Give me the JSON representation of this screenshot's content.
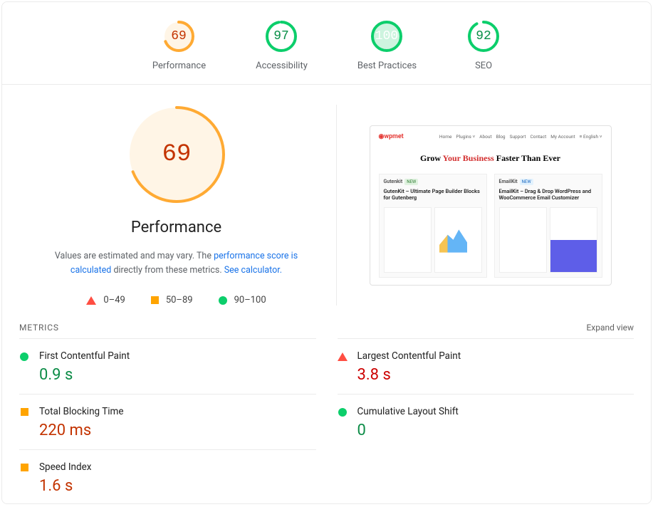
{
  "gauges": [
    {
      "label": "Performance",
      "value": 69,
      "color": "#fa3",
      "bg": "#fff5e6",
      "fill": "#fa3",
      "text": "#c33300"
    },
    {
      "label": "Accessibility",
      "value": 97,
      "color": "#0cce6b",
      "bg": "#fff",
      "fill": "none",
      "text": "#0a8f48"
    },
    {
      "label": "Best Practices",
      "value": 100,
      "color": "#0cce6b",
      "bg": "#e8faf0",
      "fill": "#0cce6b",
      "filltext": "#fff",
      "text": "#0a8f48"
    },
    {
      "label": "SEO",
      "value": 92,
      "color": "#0cce6b",
      "bg": "#fff",
      "fill": "none",
      "text": "#0a8f48"
    }
  ],
  "bigGauge": {
    "label": "Performance",
    "value": 69,
    "color": "#fa3",
    "bg": "#fff5e6",
    "text": "#c33300"
  },
  "disclaimer": {
    "prefix": "Values are estimated and may vary. The ",
    "link1": "performance score is calculated",
    "mid": " directly from these metrics. ",
    "link2": "See calculator."
  },
  "legend": {
    "fail": "0–49",
    "avg": "50–89",
    "pass": "90–100"
  },
  "screenshot": {
    "logo": "◉wpmet",
    "nav": [
      "Home",
      "Plugins ˅",
      "About",
      "Blog",
      "Support",
      "Contact",
      "My Account",
      "≡ English ˅"
    ],
    "hero_pre": "Grow ",
    "hero_accent": "Your Business",
    "hero_post": " Faster Than Ever",
    "card1_name": "Gutenkit",
    "card1_badge": "NEW",
    "card1_title": "GutenKit – Ultimate Page Builder Blocks for Gutenberg",
    "card2_name": "EmailKit",
    "card2_badge": "NEW",
    "card2_title": "EmailKit – Drag & Drop WordPress and WooCommerce Email Customizer"
  },
  "metricsHeader": {
    "title": "METRICS",
    "expand": "Expand view"
  },
  "metrics": [
    {
      "name": "First Contentful Paint",
      "value": "0.9 s",
      "status": "pass"
    },
    {
      "name": "Largest Contentful Paint",
      "value": "3.8 s",
      "status": "fail"
    },
    {
      "name": "Total Blocking Time",
      "value": "220 ms",
      "status": "avg"
    },
    {
      "name": "Cumulative Layout Shift",
      "value": "0",
      "status": "pass"
    },
    {
      "name": "Speed Index",
      "value": "1.6 s",
      "status": "avg"
    }
  ]
}
